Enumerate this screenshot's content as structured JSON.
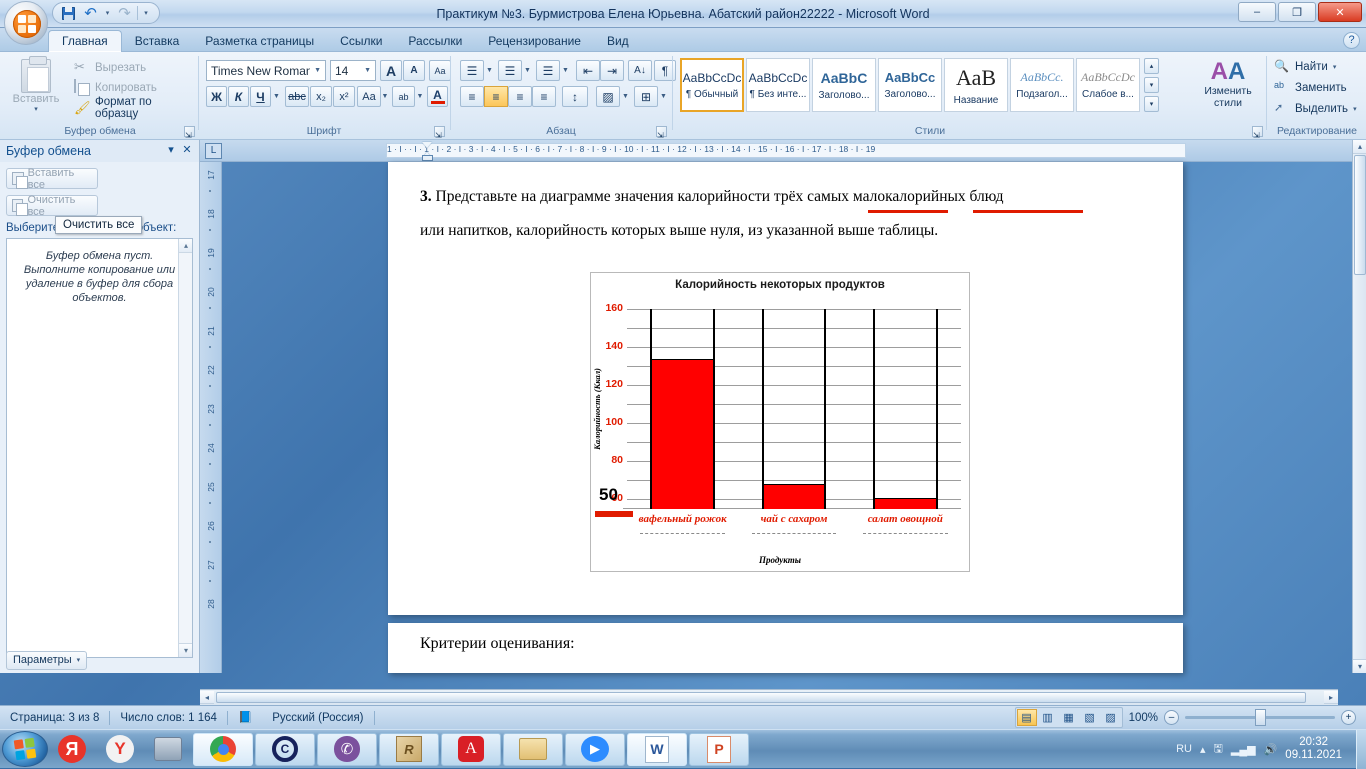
{
  "window": {
    "title": "Практикум №3. Бурмистрова Елена Юрьевна. Абатский район22222 - Microsoft Word",
    "minimize": "–",
    "maximize": "❐",
    "close": "✕",
    "help": "?"
  },
  "quick_access": {
    "save": "save-icon",
    "undo": "↶",
    "undo_caret": "▾",
    "redo": "↷",
    "customize": "▾"
  },
  "ribbon": {
    "tabs": [
      {
        "label": "Главная",
        "active": true
      },
      {
        "label": "Вставка",
        "active": false
      },
      {
        "label": "Разметка страницы",
        "active": false
      },
      {
        "label": "Ссылки",
        "active": false
      },
      {
        "label": "Рассылки",
        "active": false
      },
      {
        "label": "Рецензирование",
        "active": false
      },
      {
        "label": "Вид",
        "active": false
      }
    ],
    "clipboard": {
      "group_name": "Буфер обмена",
      "paste": "Вставить",
      "paste_caret": "▾",
      "cut": "Вырезать",
      "copy": "Копировать",
      "format_painter": "Формат по образцу"
    },
    "font": {
      "group_name": "Шрифт",
      "font_name": "Times New Roman",
      "font_size": "14",
      "grow": "A",
      "shrink": "A",
      "clear_format": "Aa",
      "bold": "Ж",
      "italic": "К",
      "underline": "Ч",
      "strike": "abc",
      "subscript": "x₂",
      "superscript": "x²",
      "change_case": "Aa",
      "highlight": "ab",
      "font_color": "A"
    },
    "paragraph": {
      "group_name": "Абзац",
      "bullets": "☰",
      "numbering": "☰",
      "multilevel": "☰",
      "decrease_indent": "⇤",
      "increase_indent": "⇥",
      "sort": "A↓",
      "show_marks": "¶",
      "align_left": "≡",
      "align_center": "≡",
      "align_right": "≡",
      "justify": "≡",
      "line_spacing": "↕",
      "shading": "▨",
      "borders": "⊞"
    },
    "styles": {
      "group_name": "Стили",
      "items": [
        {
          "sample": "AaBbCcDc",
          "name": "¶ Обычный",
          "active": true
        },
        {
          "sample": "AaBbCcDc",
          "name": "¶ Без инте...",
          "active": false
        },
        {
          "sample": "AaBbC",
          "name": "Заголово...",
          "active": false
        },
        {
          "sample": "AaBbCc",
          "name": "Заголово...",
          "active": false
        },
        {
          "sample": "АаВ",
          "name": "Название",
          "active": false
        },
        {
          "sample": "AaBbCc.",
          "name": "Подзагол...",
          "active": false
        },
        {
          "sample": "AaBbCcDc",
          "name": "Слабое в...",
          "active": false
        }
      ],
      "scroll_up": "▴",
      "scroll_down": "▾",
      "more": "▾"
    },
    "change_styles": {
      "label_line1": "Изменить",
      "label_line2": "стили",
      "caret": "▾"
    },
    "editing": {
      "group_name": "Редактирование",
      "find": "Найти",
      "find_caret": "▾",
      "replace": "Заменить",
      "select": "Выделить",
      "select_caret": "▾"
    }
  },
  "task_pane": {
    "title": "Буфер обмена",
    "menu_caret": "▾",
    "close": "✕",
    "paste_all": "Вставить все",
    "clear_all": "Очистить все",
    "hint": "Выберите вставляемый объект:",
    "empty_message": "Буфер обмена пуст. Выполните копирование или удаление в буфер для сбора объектов.",
    "options": "Параметры",
    "options_caret": "▾",
    "tooltip": "Очистить все",
    "scroll_up": "▴",
    "scroll_down": "▾"
  },
  "ruler": {
    "tab_stop_icon": "L",
    "horizontal_ticks": "1  ·  I  ·     ·  I  ·  1  ·  I  ·  2  ·  I  ·  3  ·  I  ·  4  ·  I  ·  5  ·  I  ·  6  ·  I  ·  7  ·  I  ·  8  ·  I  ·  9  ·  I  · 10 ·  I  · 11 ·  I  · 12 ·  I  · 13 ·  I  · 14 ·  I  · 15 ·  I  · 16 ·  I  · 17 ·  I  · 18 ·  I  · 19",
    "vertical_numbers": [
      "17",
      "18",
      "19",
      "20",
      "21",
      "22",
      "23",
      "24",
      "25",
      "26",
      "27",
      "28"
    ]
  },
  "document": {
    "paragraph_number": "3.",
    "line1": " Представьте на диаграмме значения калорийности трёх самых малокалорийных блюд",
    "line2": "или напитков, калорийность которых выше нуля,  из указанной выше таблицы.",
    "next_page_text": "Критерии оценивания:"
  },
  "chart_data": {
    "type": "bar",
    "title": "Калорийность некоторых продуктов",
    "categories": [
      "вафельный рожок",
      "чай с сахаром",
      "салат овощной"
    ],
    "values": [
      134,
      68,
      61
    ],
    "xlabel": "Продукты",
    "ylabel": "Калорийность (Ккал)",
    "ylim": [
      55,
      160
    ],
    "yticks": [
      60,
      80,
      100,
      120,
      140,
      160
    ],
    "gridlines": [
      60,
      70,
      80,
      90,
      100,
      110,
      120,
      130,
      140,
      150,
      160
    ],
    "grid": true,
    "legend": "none",
    "bar_color": "#ff0000",
    "tick_color": "#e01b00",
    "category_label_color": "#e01b00",
    "annotation": "50"
  },
  "status_bar": {
    "page": "Страница: 3 из 8",
    "words": "Число слов: 1 164",
    "proofing_icon": "spellcheck-icon",
    "language": "Русский (Россия)",
    "zoom": "100%",
    "zoom_out": "–",
    "zoom_in": "+",
    "views": [
      {
        "icon": "print-layout-icon",
        "active": true
      },
      {
        "icon": "full-screen-reading-icon",
        "active": false
      },
      {
        "icon": "web-layout-icon",
        "active": false
      },
      {
        "icon": "outline-icon",
        "active": false
      },
      {
        "icon": "draft-icon",
        "active": false
      }
    ]
  },
  "taskbar": {
    "start": "start-button",
    "pinned": [
      {
        "name": "yandex-icon",
        "glyph": "Я"
      },
      {
        "name": "yandex-browser-icon",
        "glyph": "Y"
      },
      {
        "name": "printer-icon",
        "glyph": "🖨"
      }
    ],
    "apps": [
      {
        "name": "chrome-icon",
        "glyph": "◉"
      },
      {
        "name": "consultant-plus-icon",
        "glyph": "C"
      },
      {
        "name": "viber-icon",
        "glyph": "✆"
      },
      {
        "name": "rs-cube-icon",
        "glyph": "R"
      },
      {
        "name": "adobe-reader-icon",
        "glyph": "A"
      },
      {
        "name": "folder-icon",
        "glyph": "🗀"
      },
      {
        "name": "zoom-icon",
        "glyph": "▣"
      },
      {
        "name": "word-icon",
        "glyph": "W"
      },
      {
        "name": "powerpoint-icon",
        "glyph": "P"
      }
    ],
    "tray": {
      "language": "RU",
      "show_hidden": "▴",
      "safely_remove": "safely-remove-icon",
      "network": "network-icon",
      "volume": "volume-icon",
      "time": "20:32",
      "date": "09.11.2021"
    }
  }
}
